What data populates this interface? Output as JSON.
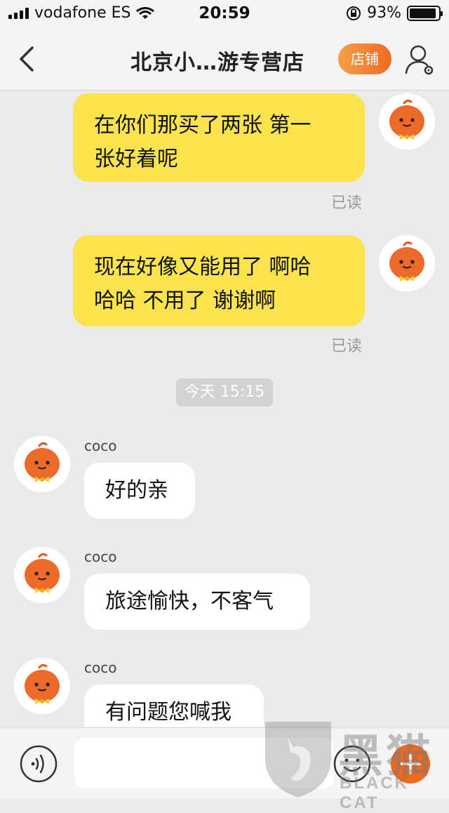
{
  "status_bar": {
    "carrier": "vodafone ES",
    "time": "20:59",
    "battery_percent": "93%",
    "battery_level": 0.93
  },
  "header": {
    "title": "北京小…游专营店",
    "shop_button": "店铺"
  },
  "messages": [
    {
      "direction": "out",
      "lines": [
        "在你们那买了两张 第一",
        "张好着呢"
      ],
      "status": "已读"
    },
    {
      "direction": "out",
      "lines": [
        "现在好像又能用了 啊哈",
        "哈哈 不用了 谢谢啊"
      ],
      "status": "已读"
    },
    {
      "direction": "in",
      "sender": "coco",
      "text": "好的亲"
    },
    {
      "direction": "in",
      "sender": "coco",
      "text": "旅途愉快，不客气"
    },
    {
      "direction": "in",
      "sender": "coco",
      "text": "有问题您喊我"
    }
  ],
  "time_divider": "今天 15:15",
  "input": {
    "placeholder": ""
  },
  "watermark": {
    "cn": "黑猫",
    "en": "BLACK CAT"
  },
  "icons": [
    "back-chevron-icon",
    "user-settings-icon",
    "voice-icon",
    "emoji-icon",
    "plus-icon",
    "pumpkin-avatar-icon"
  ],
  "colors": {
    "outgoing_bubble": "#fbe34e",
    "incoming_bubble": "#ffffff",
    "shop_button": "#ef6a21",
    "background": "#ebebeb"
  }
}
